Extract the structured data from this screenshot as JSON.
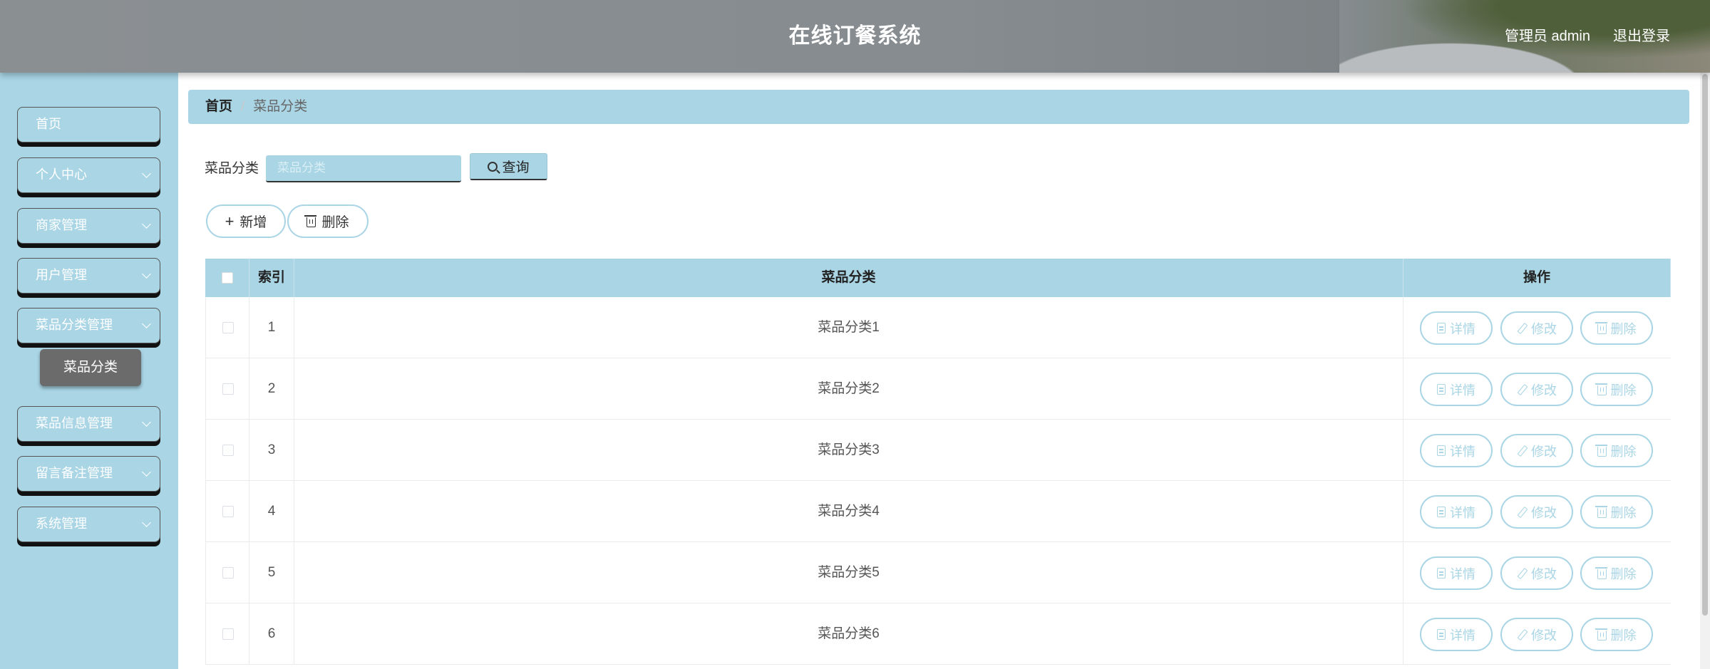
{
  "header": {
    "title": "在线订餐系统",
    "user": "管理员 admin",
    "logout": "退出登录"
  },
  "sidebar": {
    "items": [
      {
        "label": "首页"
      },
      {
        "label": "个人中心"
      },
      {
        "label": "商家管理"
      },
      {
        "label": "用户管理"
      },
      {
        "label": "菜品分类管理"
      },
      {
        "label": "菜品信息管理"
      },
      {
        "label": "留言备注管理"
      },
      {
        "label": "系统管理"
      }
    ],
    "submenu": {
      "label": "菜品分类"
    }
  },
  "breadcrumb": {
    "home": "首页",
    "separator": "/",
    "current": "菜品分类"
  },
  "search": {
    "label": "菜品分类",
    "placeholder": "菜品分类",
    "button": "查询"
  },
  "toolbar": {
    "add": "新增",
    "delete": "删除"
  },
  "table": {
    "columns": {
      "index": "索引",
      "name": "菜品分类",
      "actions": "操作"
    },
    "rows": [
      {
        "index": "1",
        "name": "菜品分类1"
      },
      {
        "index": "2",
        "name": "菜品分类2"
      },
      {
        "index": "3",
        "name": "菜品分类3"
      },
      {
        "index": "4",
        "name": "菜品分类4"
      },
      {
        "index": "5",
        "name": "菜品分类5"
      },
      {
        "index": "6",
        "name": "菜品分类6"
      }
    ],
    "actions": {
      "detail": "详情",
      "edit": "修改",
      "delete": "删除"
    }
  },
  "colors": {
    "accent": "#a9d5e5",
    "header": "#878c90",
    "active_submenu": "#6b6b6b"
  }
}
